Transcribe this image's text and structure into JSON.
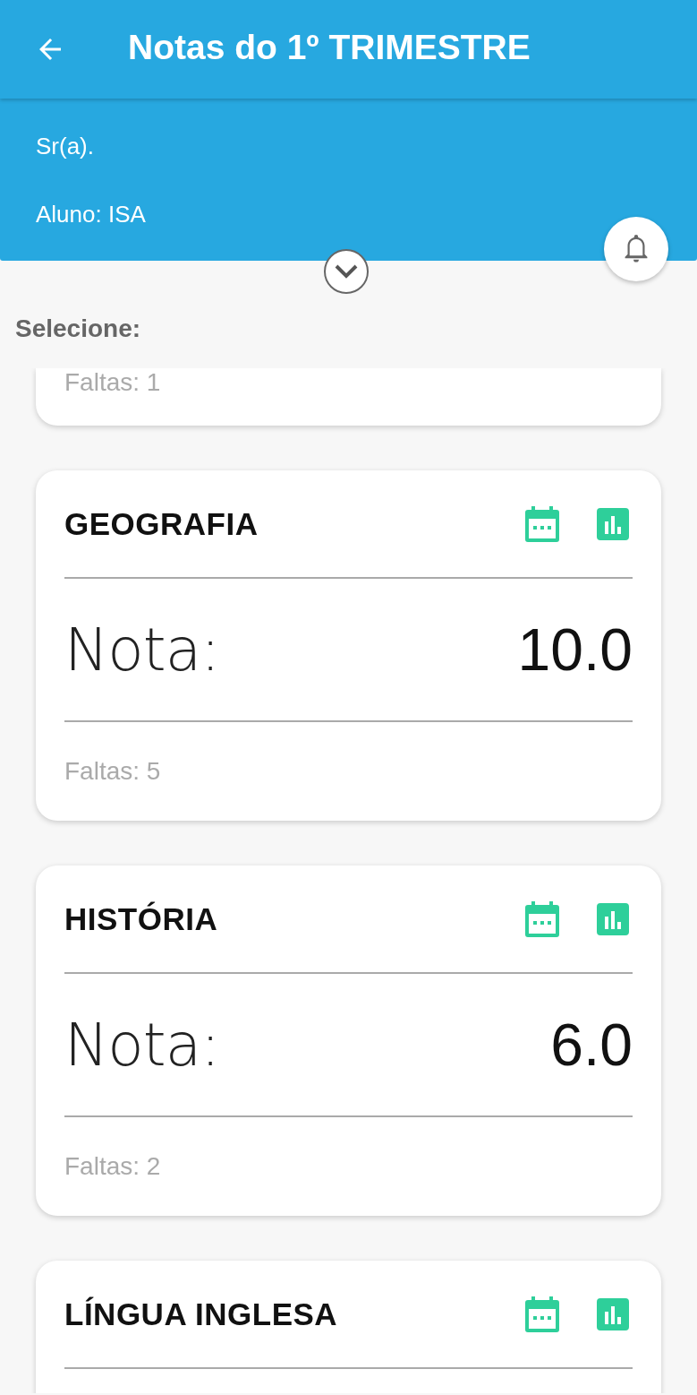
{
  "app_bar": {
    "title": "Notas do 1º TRIMESTRE"
  },
  "info_panel": {
    "greeting": "Sr(a).",
    "student": "Aluno: ISA"
  },
  "section_label": "Selecione:",
  "cards": [
    {
      "absences": "Faltas: 1"
    },
    {
      "subject": "GEOGRAFIA",
      "grade_label": "Nota:",
      "grade": "10.0",
      "absences": "Faltas: 5"
    },
    {
      "subject": "HISTÓRIA",
      "grade_label": "Nota:",
      "grade": "6.0",
      "absences": "Faltas: 2"
    },
    {
      "subject": "LÍNGUA INGLESA"
    }
  ]
}
